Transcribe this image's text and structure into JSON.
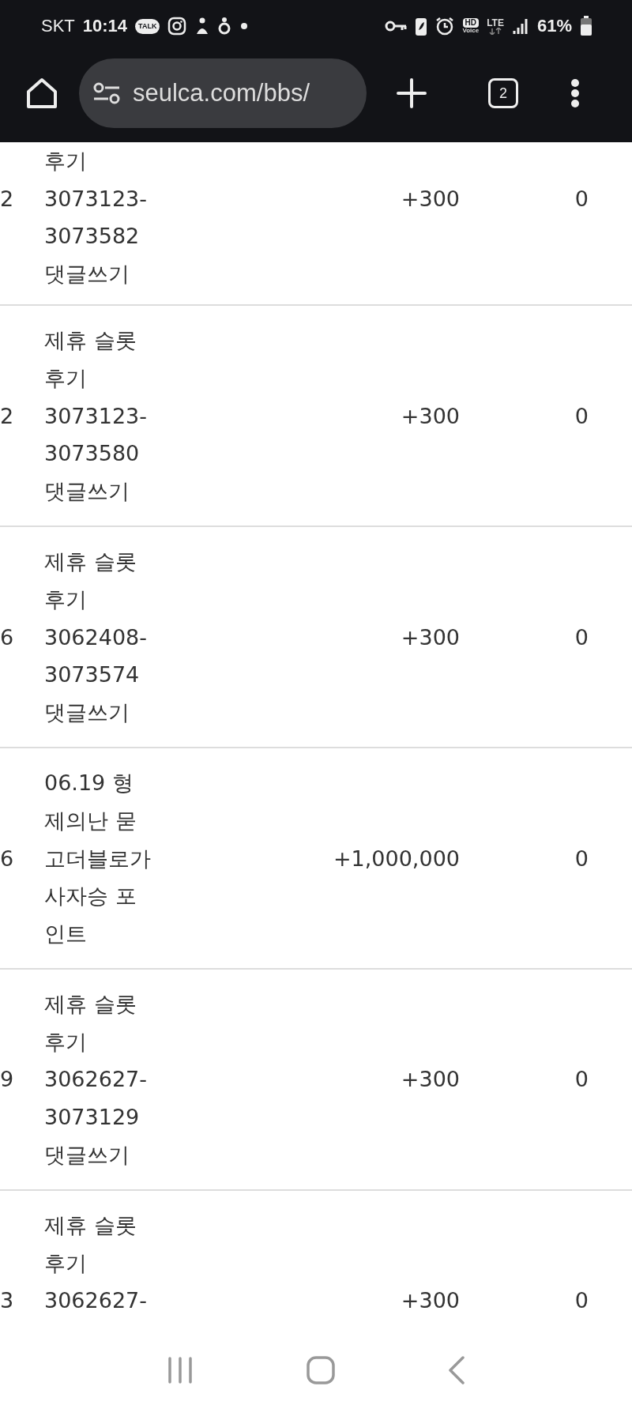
{
  "status_bar": {
    "carrier": "SKT",
    "time": "10:14",
    "talk_badge": "TALK",
    "hd_label": "HD",
    "voice_label": "Voice",
    "network": "LTE",
    "battery": "61%"
  },
  "browser": {
    "url": "seulca.com/bbs/",
    "tab_count": "2"
  },
  "rows": [
    {
      "col_1": "2",
      "title_lines": [
        "후기",
        "3073123-",
        "3073582",
        "댓글쓰기"
      ],
      "points": "+300",
      "col_4": "0"
    },
    {
      "col_1": "2",
      "title_lines": [
        "제휴 슬롯",
        "후기",
        "3073123-",
        "3073580",
        "댓글쓰기"
      ],
      "points": "+300",
      "col_4": "0"
    },
    {
      "col_1": "6",
      "title_lines": [
        "제휴 슬롯",
        "후기",
        "3062408-",
        "3073574",
        "댓글쓰기"
      ],
      "points": "+300",
      "col_4": "0"
    },
    {
      "col_1": "6",
      "title_lines": [
        "06.19 형",
        "제의난 묻",
        "고더블로가",
        "사자승 포",
        "인트"
      ],
      "points": "+1,000,000",
      "col_4": "0"
    },
    {
      "col_1": "9",
      "title_lines": [
        "제휴 슬롯",
        "후기",
        "3062627-",
        "3073129",
        "댓글쓰기"
      ],
      "points": "+300",
      "col_4": "0"
    },
    {
      "col_1": "3",
      "title_lines": [
        "제휴 슬롯",
        "후기",
        "3062627-"
      ],
      "points": "+300",
      "col_4": "0"
    }
  ]
}
